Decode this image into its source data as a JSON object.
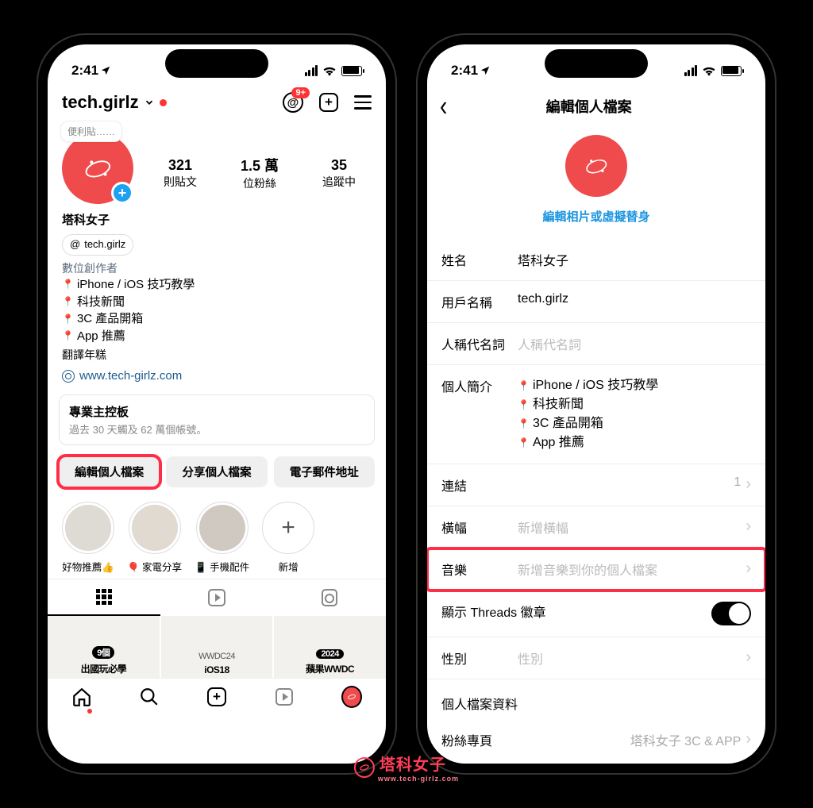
{
  "status": {
    "time": "2:41"
  },
  "left": {
    "username": "tech.girlz",
    "badge": "9+",
    "note": "便利貼……",
    "stats": {
      "posts_num": "321",
      "posts_lbl": "則貼文",
      "followers_num": "1.5 萬",
      "followers_lbl": "位粉絲",
      "following_num": "35",
      "following_lbl": "追蹤中"
    },
    "name": "塔科女子",
    "threads_handle": "tech.girlz",
    "category": "數位創作者",
    "bio1": "iPhone / iOS 技巧教學",
    "bio2": "科技新聞",
    "bio3": "3C 產品開箱",
    "bio4": "App 推薦",
    "translate": "翻譯年糕",
    "link": "www.tech-girlz.com",
    "dashboard_title": "專業主控板",
    "dashboard_sub": "過去 30 天觸及 62 萬個帳號。",
    "btn_edit": "編輯個人檔案",
    "btn_share": "分享個人檔案",
    "btn_email": "電子郵件地址",
    "hl1": "好物推薦👍",
    "hl2": "🎈 家電分享",
    "hl3": "📱 手機配件",
    "hl4": "新增",
    "post1_top": "9個",
    "post1": "出國玩必學",
    "post2_top": "WWDC24",
    "post2": "iOS18",
    "post3_top": "2024",
    "post3": "蘋果WWDC"
  },
  "right": {
    "title": "編輯個人檔案",
    "edit_photo": "編輯相片或虛擬替身",
    "f_name_lbl": "姓名",
    "f_name_val": "塔科女子",
    "f_user_lbl": "用戶名稱",
    "f_user_val": "tech.girlz",
    "f_pron_lbl": "人稱代名詞",
    "f_pron_ph": "人稱代名詞",
    "f_bio_lbl": "個人簡介",
    "f_bio1": "iPhone / iOS 技巧教學",
    "f_bio2": "科技新聞",
    "f_bio3": "3C 產品開箱",
    "f_bio4": "App 推薦",
    "f_links_lbl": "連結",
    "f_links_val": "1",
    "f_banner_lbl": "橫幅",
    "f_banner_ph": "新增橫幅",
    "f_music_lbl": "音樂",
    "f_music_ph": "新增音樂到你的個人檔案",
    "f_threads_lbl": "顯示 Threads 徽章",
    "f_gender_lbl": "性別",
    "f_gender_ph": "性別",
    "section": "個人檔案資料",
    "f_fanpage_lbl": "粉絲專頁",
    "f_fanpage_val": "塔科女子 3C & APP"
  },
  "watermark": {
    "text": "塔科女子",
    "sub": "www.tech-girlz.com"
  }
}
